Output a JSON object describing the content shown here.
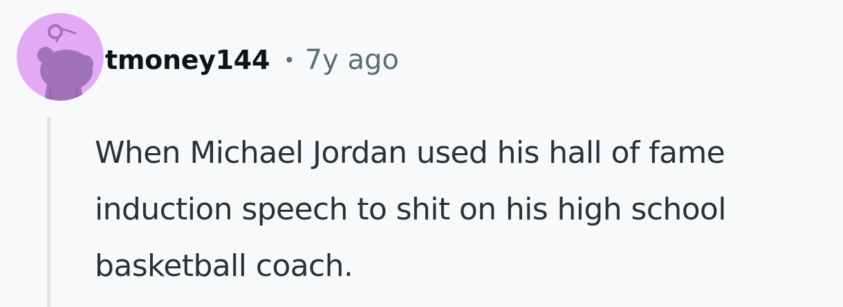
{
  "comment": {
    "author": "tmoney144",
    "separator": "•",
    "time_ago": "7y ago",
    "body": "When Michael Jordan used his hall of fame induction speech to shit on his high school basketball coach.",
    "avatar_icon": "snoo-avatar-icon",
    "colors": {
      "avatar_background": "#e4a9f5",
      "avatar_figure": "#a072b8",
      "page_background": "#f8f9fa",
      "thread_line": "#dfe3e6"
    }
  }
}
